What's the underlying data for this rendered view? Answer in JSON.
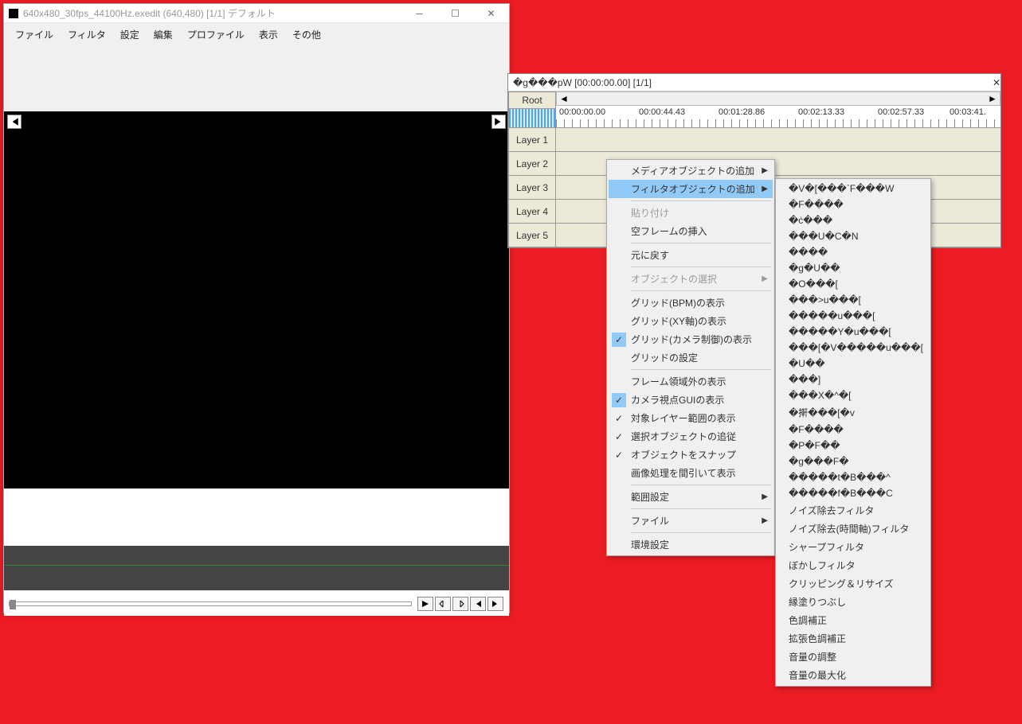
{
  "main_window": {
    "title": "640x480_30fps_44100Hz.exedit (640,480)  [1/1]  デフォルト",
    "menubar": [
      "ファイル",
      "フィルタ",
      "設定",
      "編集",
      "プロファイル",
      "表示",
      "その他"
    ]
  },
  "timeline_window": {
    "title": "�g���pW [00:00:00.00] [1/1]",
    "root": "Root",
    "layers": [
      "Layer 1",
      "Layer 2",
      "Layer 3",
      "Layer 4",
      "Layer 5"
    ],
    "timecodes": [
      "00:00:00.00",
      "00:00:44.43",
      "00:01:28.86",
      "00:02:13.33",
      "00:02:57.33",
      "00:03:41."
    ]
  },
  "context_menu": {
    "items": [
      {
        "label": "メディアオブジェクトの追加",
        "sub": true
      },
      {
        "label": "フィルタオブジェクトの追加",
        "sub": true,
        "hl": true
      },
      {
        "sep": true
      },
      {
        "label": "貼り付け",
        "disabled": true
      },
      {
        "label": "空フレームの挿入"
      },
      {
        "sep": true
      },
      {
        "label": "元に戻す"
      },
      {
        "sep": true
      },
      {
        "label": "オブジェクトの選択",
        "sub": true,
        "disabled": true
      },
      {
        "sep": true
      },
      {
        "label": "グリッド(BPM)の表示"
      },
      {
        "label": "グリッド(XY軸)の表示"
      },
      {
        "label": "グリッド(カメラ制御)の表示",
        "checked": true,
        "checkHl": true
      },
      {
        "label": "グリッドの設定"
      },
      {
        "sep": true
      },
      {
        "label": "フレーム領域外の表示"
      },
      {
        "label": "カメラ視点GUIの表示",
        "checked": true,
        "checkHl": true
      },
      {
        "label": "対象レイヤー範囲の表示",
        "checked": true
      },
      {
        "label": "選択オブジェクトの追従",
        "checked": true
      },
      {
        "label": "オブジェクトをスナップ",
        "checked": true
      },
      {
        "label": "画像処理を間引いて表示"
      },
      {
        "sep": true
      },
      {
        "label": "範囲設定",
        "sub": true
      },
      {
        "sep": true
      },
      {
        "label": "ファイル",
        "sub": true
      },
      {
        "sep": true
      },
      {
        "label": "環境設定"
      }
    ]
  },
  "submenu": {
    "items": [
      "�V�[���`F���W",
      "�F����",
      "�ċ���",
      "���U�C�N",
      "����",
      "�g�U��",
      "�O���[",
      "���>u���[",
      "�����u���[",
      "�����Y�u���[",
      "���[�V�����u���[",
      "�U��",
      "���]",
      "���X�^�[",
      "�搟���[�v",
      "�F����",
      "�P�F��",
      "�g���F�␳�",
      "�����t�B���^",
      "�����f�B���C",
      "ノイズ除去フィルタ",
      "ノイズ除去(時間軸)フィルタ",
      "シャープフィルタ",
      "ぼかしフィルタ",
      "クリッピング＆リサイズ",
      "縁塗りつぶし",
      "色調補正",
      "拡張色調補正",
      "音量の調整",
      "音量の最大化"
    ]
  }
}
